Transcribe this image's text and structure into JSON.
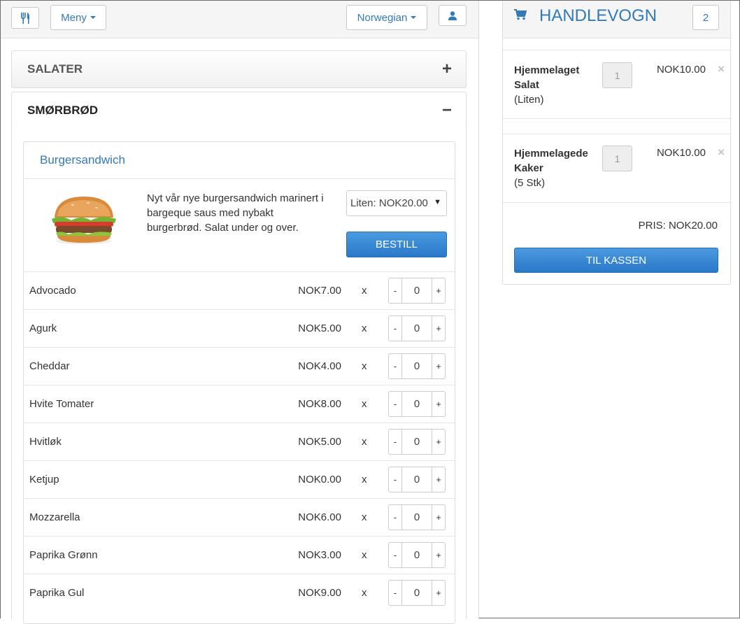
{
  "topbar": {
    "menu_label": "Meny",
    "language_label": "Norwegian"
  },
  "categories": [
    {
      "name": "SALATER",
      "sign": "+"
    },
    {
      "name": "SMØRBRØD",
      "sign": "−"
    }
  ],
  "product": {
    "title": "Burgersandwich",
    "description": "Nyt vår nye burgersandwich marinert i bargeque saus med nybakt burgerbrød. Salat under og over.",
    "size_selected": "Liten: NOK20.00",
    "order_label": "BESTILL"
  },
  "toppings": [
    {
      "name": "Advocado",
      "price": "NOK7.00",
      "x": "x",
      "qty": "0"
    },
    {
      "name": "Agurk",
      "price": "NOK5.00",
      "x": "x",
      "qty": "0"
    },
    {
      "name": "Cheddar",
      "price": "NOK4.00",
      "x": "x",
      "qty": "0"
    },
    {
      "name": "Hvite Tomater",
      "price": "NOK8.00",
      "x": "x",
      "qty": "0"
    },
    {
      "name": "Hvitløk",
      "price": "NOK5.00",
      "x": "x",
      "qty": "0"
    },
    {
      "name": "Ketjup",
      "price": "NOK0.00",
      "x": "x",
      "qty": "0"
    },
    {
      "name": "Mozzarella",
      "price": "NOK6.00",
      "x": "x",
      "qty": "0"
    },
    {
      "name": "Paprika Grønn",
      "price": "NOK3.00",
      "x": "x",
      "qty": "0"
    },
    {
      "name": "Paprika Gul",
      "price": "NOK9.00",
      "x": "x",
      "qty": "0"
    }
  ],
  "stepper": {
    "minus": "-",
    "plus": "+"
  },
  "cart": {
    "title": "HANDLEVOGN",
    "count": "2",
    "items": [
      {
        "name_line1": "Hjemmelaget",
        "name_line2": "Salat",
        "variant": "(Liten)",
        "qty": "1",
        "price": "NOK10.00",
        "remove": "×"
      },
      {
        "name_line1": "Hjemmelagede",
        "name_line2": "Kaker",
        "variant": "(5 Stk)",
        "qty": "1",
        "price": "NOK10.00",
        "remove": "×"
      }
    ],
    "total": "PRIS: NOK20.00",
    "checkout_label": "TIL KASSEN"
  },
  "colors": {
    "accent": "#337ab7",
    "button_primary": "#3a88d5"
  }
}
